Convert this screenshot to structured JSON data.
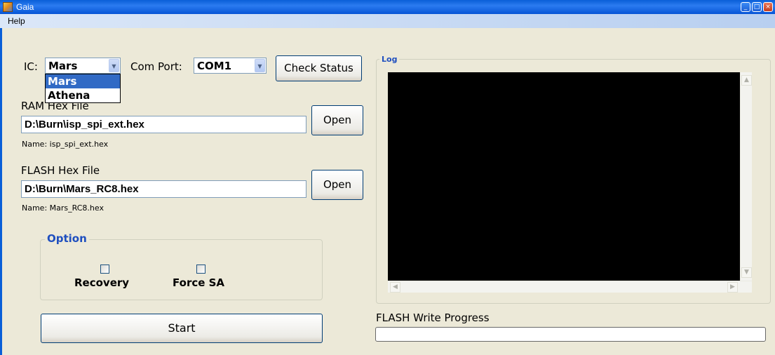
{
  "window": {
    "title": "Gaia",
    "controls": [
      "_",
      "□",
      "×"
    ]
  },
  "menu": {
    "items": [
      "Help"
    ]
  },
  "ic": {
    "label": "IC:",
    "value": "Mars",
    "options": [
      "Mars",
      "Athena"
    ]
  },
  "com_port": {
    "label": "Com Port:",
    "value": "COM1"
  },
  "check_status": {
    "label": "Check Status"
  },
  "ram": {
    "label": "RAM Hex File",
    "path": "D:\\Burn\\isp_spi_ext.hex",
    "name": "Name: isp_spi_ext.hex",
    "open_label": "Open"
  },
  "flash": {
    "label": "FLASH Hex File",
    "path": "D:\\Burn\\Mars_RC8.hex",
    "name": "Name: Mars_RC8.hex",
    "open_label": "Open"
  },
  "option": {
    "title": "Option",
    "recovery": "Recovery",
    "force_sa": "Force SA"
  },
  "start": {
    "label": "Start"
  },
  "log": {
    "title": "Log"
  },
  "progress": {
    "label": "FLASH Write Progress",
    "value": 0
  },
  "colors": {
    "titlebar": "#0a5fd8",
    "group_title": "#1f4fbf",
    "log_bg": "#000000",
    "selection": "#316ac5"
  }
}
